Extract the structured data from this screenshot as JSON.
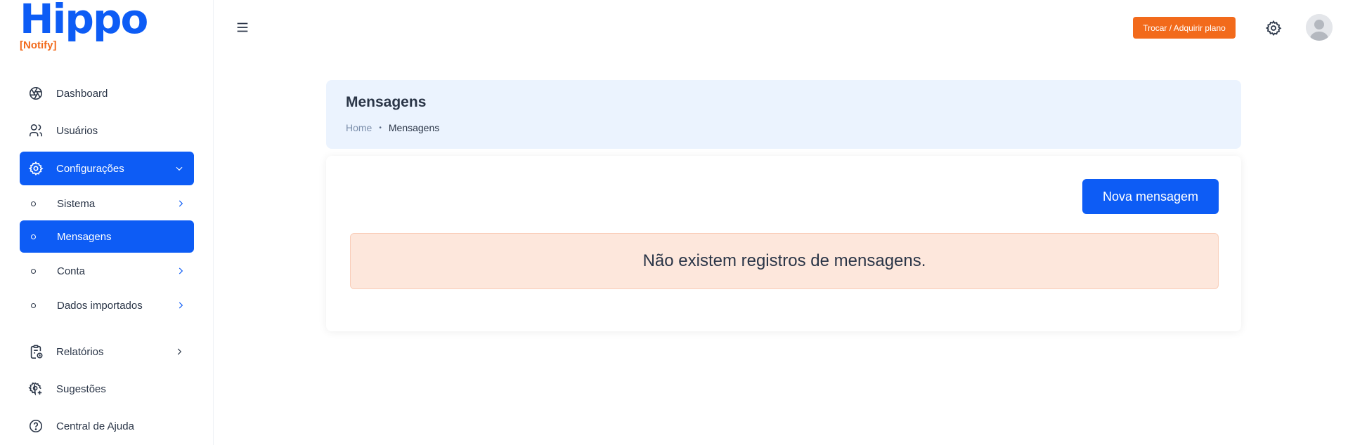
{
  "brand": {
    "name": "Hippo",
    "tagline": "[Notify]",
    "primary_color": "#0d5cf5",
    "accent_color": "#f26a1b"
  },
  "sidebar": {
    "items": [
      {
        "label": "Dashboard",
        "icon": "aperture-icon"
      },
      {
        "label": "Usuários",
        "icon": "users-icon"
      },
      {
        "label": "Configurações",
        "icon": "gear-icon",
        "expanded": true,
        "active": true
      },
      {
        "label": "Relatórios",
        "icon": "clipboard-clock-icon"
      },
      {
        "label": "Sugestões",
        "icon": "gear-plus-icon"
      },
      {
        "label": "Central de Ajuda",
        "icon": "help-circle-icon"
      }
    ],
    "sub_items": [
      {
        "label": "Sistema"
      },
      {
        "label": "Mensagens",
        "active": true
      },
      {
        "label": "Conta"
      },
      {
        "label": "Dados importados"
      }
    ]
  },
  "topbar": {
    "plan_button": "Trocar / Adquirir plano",
    "menu_icon": "hamburger-icon",
    "settings_icon": "gear-icon",
    "avatar_icon": "user-avatar-icon"
  },
  "page": {
    "title": "Mensagens",
    "breadcrumb": {
      "home": "Home",
      "separator": "•",
      "current": "Mensagens"
    }
  },
  "content": {
    "new_button": "Nova mensagem",
    "empty_message": "Não existem registros de mensagens."
  }
}
